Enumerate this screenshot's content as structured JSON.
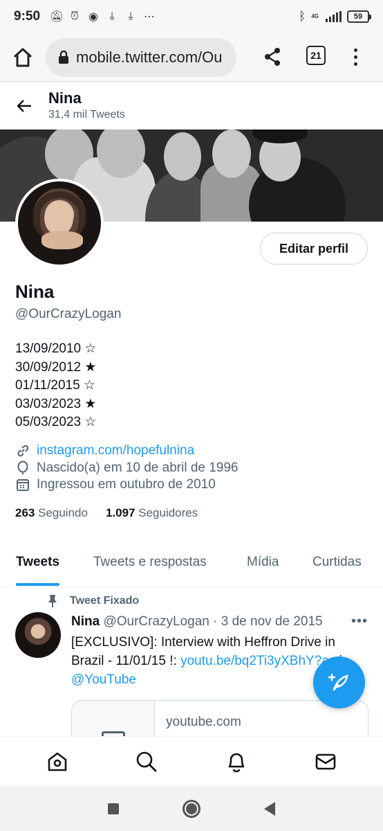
{
  "status_bar": {
    "time": "9:50",
    "battery": "59",
    "network": "4G"
  },
  "browser": {
    "url": "mobile.twitter.com/Ou",
    "tab_count": "21"
  },
  "header": {
    "name": "Nina",
    "tweet_count": "31,4 mil Tweets"
  },
  "profile": {
    "edit_button": "Editar perfil",
    "name": "Nina",
    "handle": "@OurCrazyLogan",
    "bio_lines": [
      "13/09/2010 ☆",
      "30/09/2012 ★",
      "01/11/2015 ☆",
      "03/03/2023 ★",
      "05/03/2023 ☆"
    ],
    "link": "instagram.com/hopefulnina",
    "birthday": "Nascido(a) em 10 de abril de 1996",
    "joined": "Ingressou em outubro de 2010",
    "following_count": "263",
    "following_label": "Seguindo",
    "followers_count": "1.097",
    "followers_label": "Seguidores"
  },
  "tabs": [
    "Tweets",
    "Tweets e respostas",
    "Mídia",
    "Curtidas"
  ],
  "pinned_tweet": {
    "pinned_label": "Tweet Fixado",
    "author": "Nina",
    "handle_date": "@OurCrazyLogan · 3 de nov de 2015",
    "more": "•••",
    "text_prefix": "[EXCLUSIVO]: Interview with Heffron Drive in Brazil - 11/01/15 !: ",
    "text_link": "youtu.be/bq2Ti3yXBhY?a",
    "text_middle": " via ",
    "text_mention": "@YouTube",
    "card_domain": "youtube.com"
  },
  "colors": {
    "accent": "#1d9bf0",
    "secondary_text": "#536471",
    "primary_text": "#0f1419"
  },
  "icons": {
    "bottom_nav": [
      "home-icon",
      "search-icon",
      "bell-icon",
      "mail-icon"
    ],
    "fab": "compose-tweet-icon"
  }
}
